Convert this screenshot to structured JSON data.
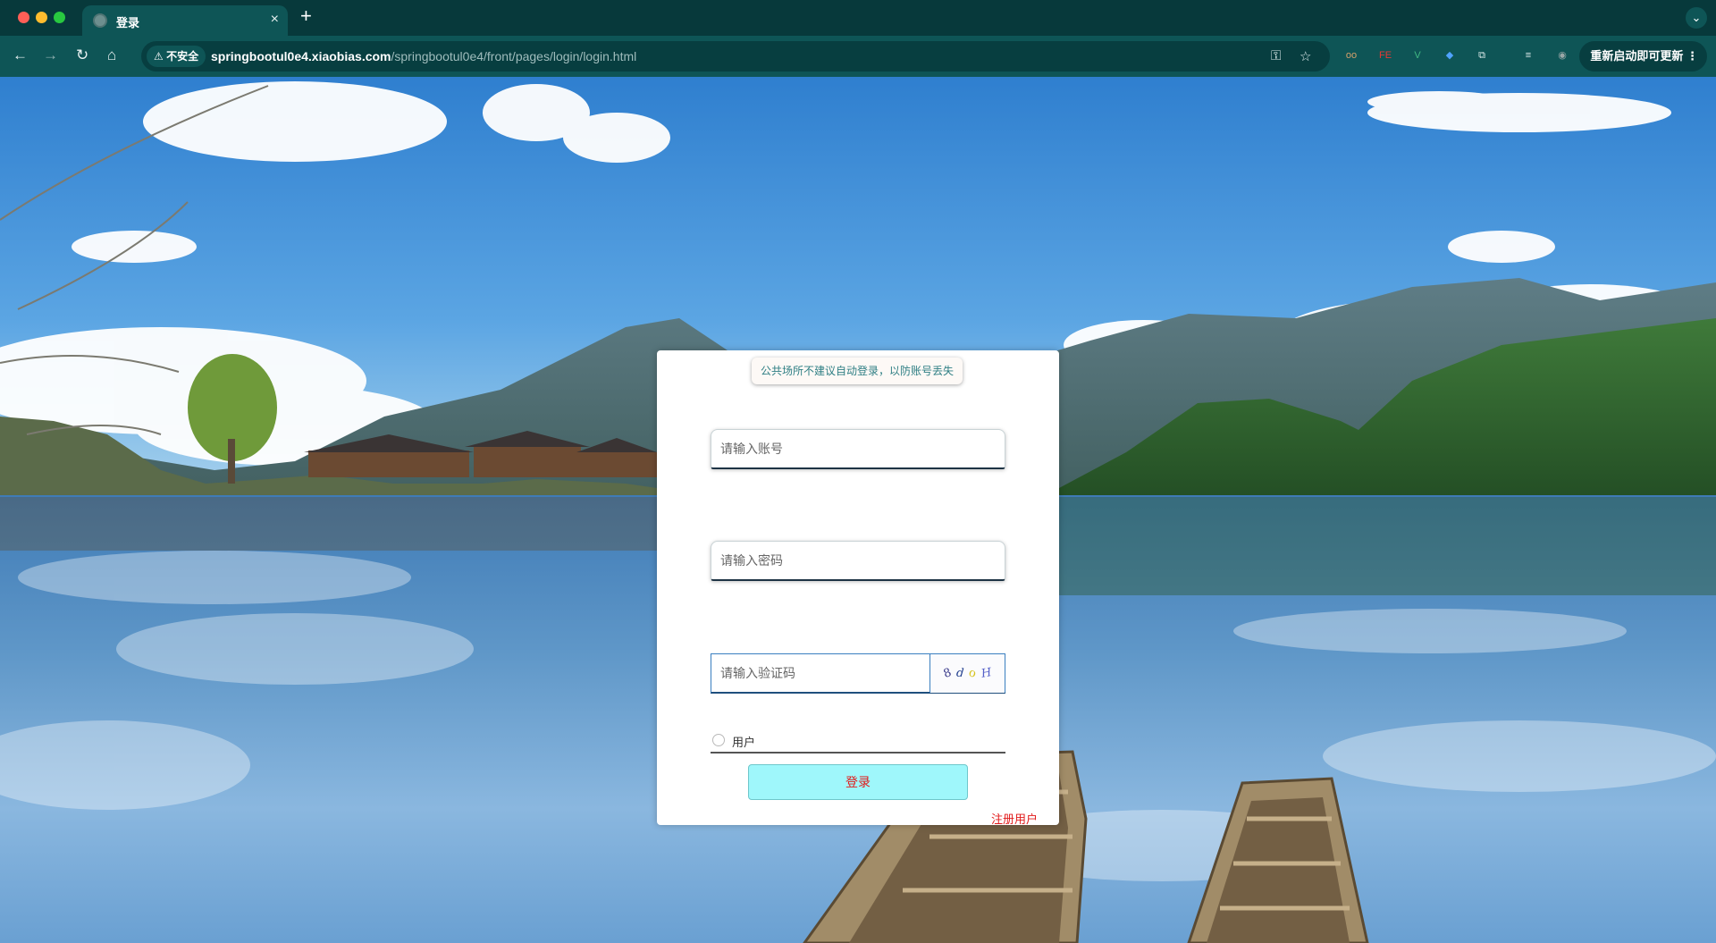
{
  "browser": {
    "tab_title": "登录",
    "tab_close": "×",
    "new_tab": "+",
    "tab_menu": "⌄",
    "security_label": "⚠ 不安全",
    "url_host": "springbootul0e4.xiaobias.com",
    "url_path": "/springbootul0e4/front/pages/login/login.html",
    "update_label": "重新启动即可更新 ⋮",
    "nav": {
      "back": "←",
      "forward": "→",
      "reload": "↻",
      "home": "⌂"
    },
    "omnibox_icons": {
      "password": "⚿",
      "bookmark": "☆"
    },
    "extensions": [
      {
        "name": "extension-icon-1",
        "glyph": "oo",
        "color": "#d5a06b"
      },
      {
        "name": "extension-icon-fe",
        "glyph": "FE",
        "color": "#e53935"
      },
      {
        "name": "extension-icon-vue",
        "glyph": "V",
        "color": "#41b883"
      },
      {
        "name": "extension-icon-4",
        "glyph": "◆",
        "color": "#4fa3ff"
      },
      {
        "name": "extensions-puzzle-icon",
        "glyph": "⧉",
        "color": "#e0eeee"
      },
      {
        "name": "reading-list-icon",
        "glyph": "≡",
        "color": "#e0eeee"
      },
      {
        "name": "profile-avatar",
        "glyph": "◉",
        "color": "#9aa7a7"
      }
    ]
  },
  "login": {
    "notice": "公共场所不建议自动登录，以防账号丢失",
    "account_placeholder": "请输入账号",
    "password_placeholder": "请输入密码",
    "captcha_placeholder": "请输入验证码",
    "captcha_chars": [
      {
        "char": "8",
        "color": "#3a3a8a"
      },
      {
        "char": "d",
        "color": "#1e3c8c"
      },
      {
        "char": "o",
        "color": "#d6c21a"
      },
      {
        "char": "H",
        "color": "#5560c8"
      }
    ],
    "role_option": "用户",
    "login_button": "登录",
    "register_link": "注册用户"
  }
}
